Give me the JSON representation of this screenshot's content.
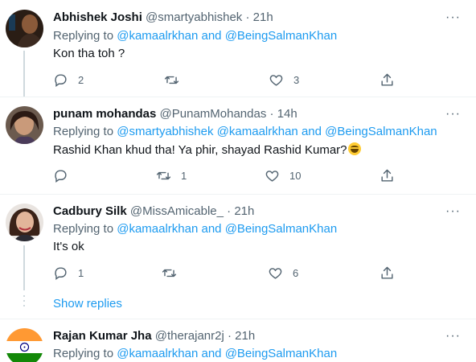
{
  "tweets": [
    {
      "name": "Abhishek Joshi",
      "handle": "@smartyabhishek",
      "dot": "·",
      "time": "21h",
      "replying_prefix": "Replying to ",
      "mentions": [
        "@kamaalrkhan",
        "@BeingSalmanKhan"
      ],
      "and_word": " and ",
      "text": "Kon tha toh ?",
      "replies": "2",
      "retweets": "",
      "likes": "3"
    },
    {
      "name": "punam mohandas",
      "handle": "@PunamMohandas",
      "dot": "·",
      "time": "14h",
      "replying_prefix": "Replying to ",
      "mentions": [
        "@smartyabhishek",
        "@kamaalrkhan",
        "@BeingSalmanKhan"
      ],
      "and_word": " and ",
      "text": "Rashid Khan khud tha!  Ya phir, shayad Rashid Kumar?",
      "replies": "",
      "retweets": "1",
      "likes": "10"
    },
    {
      "name": "Cadbury Silk",
      "handle": "@MissAmicable_",
      "dot": "·",
      "time": "21h",
      "replying_prefix": "Replying to ",
      "mentions": [
        "@kamaalrkhan",
        "@BeingSalmanKhan"
      ],
      "and_word": " and ",
      "text": "It's ok",
      "replies": "1",
      "retweets": "",
      "likes": "6"
    },
    {
      "name": "Rajan Kumar Jha",
      "handle": "@therajanr2j",
      "dot": "·",
      "time": "21h",
      "replying_prefix": "Replying to ",
      "mentions": [
        "@kamaalrkhan",
        "@BeingSalmanKhan"
      ],
      "and_word": " and "
    }
  ],
  "show_replies": "Show replies",
  "more_label": "···",
  "icons": {
    "reply": "reply-icon",
    "retweet": "retweet-icon",
    "like": "heart-icon",
    "share": "share-icon",
    "more": "more-icon"
  },
  "colors": {
    "link": "#1d9bf0",
    "secondary": "#536471",
    "primary": "#0f1419",
    "divider": "#eff3f4"
  }
}
